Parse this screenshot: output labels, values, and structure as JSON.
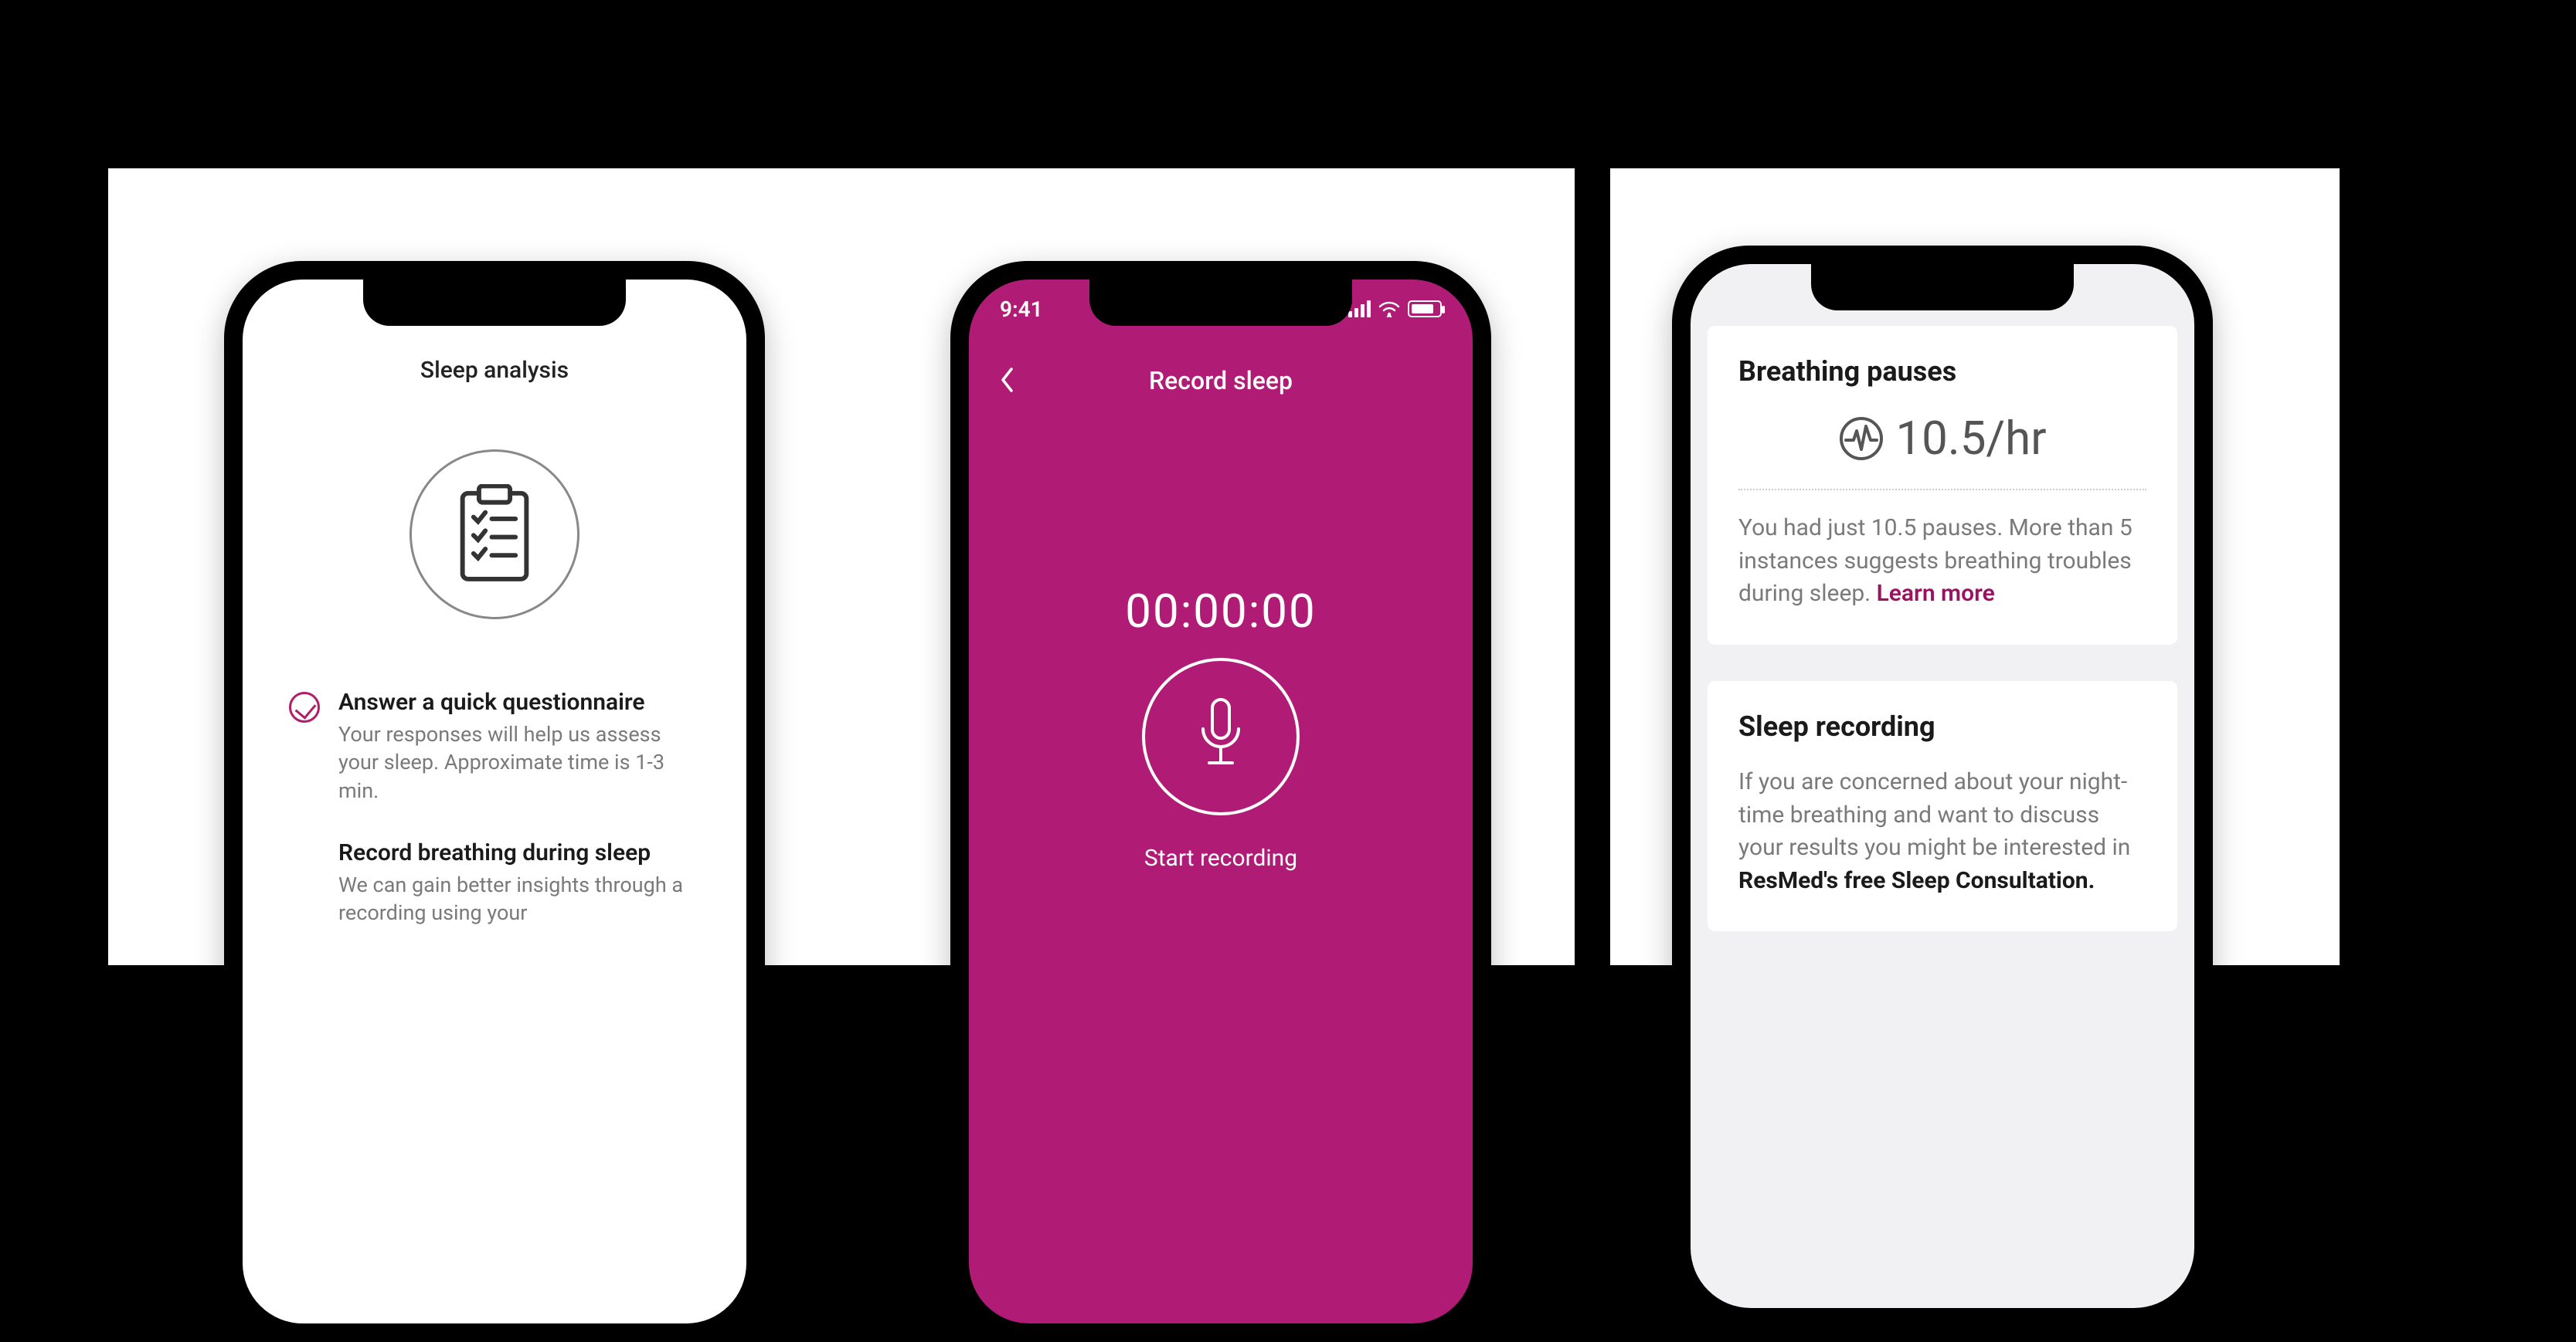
{
  "colors": {
    "accent": "#b01b76",
    "link": "#9b1262",
    "text": "#1a1a1a",
    "muted": "#7a7a7a"
  },
  "phone1": {
    "title": "Sleep analysis",
    "items": [
      {
        "status": "done",
        "title": "Answer a quick questionnaire",
        "desc": "Your responses will help us assess your sleep. Approximate time is 1-3 min."
      },
      {
        "status": "pending",
        "title": "Record breathing during sleep",
        "desc": "We can gain better insights through a recording using your"
      }
    ]
  },
  "phone2": {
    "status_time": "9:41",
    "nav_title": "Record sleep",
    "timer": "00:00:00",
    "start_label": "Start recording"
  },
  "phone3": {
    "card1": {
      "title": "Breathing pauses",
      "metric_value": "10.5/hr",
      "desc": "You had just 10.5 pauses. More than 5 instances suggests breathing troubles during sleep. ",
      "link_label": "Learn more"
    },
    "card2": {
      "title": "Sleep recording",
      "desc_pre": "If you are concerned about your night-time breathing and want to discuss your results you might be interested in ",
      "desc_strong": "ResMed's free Sleep Consultation."
    }
  }
}
